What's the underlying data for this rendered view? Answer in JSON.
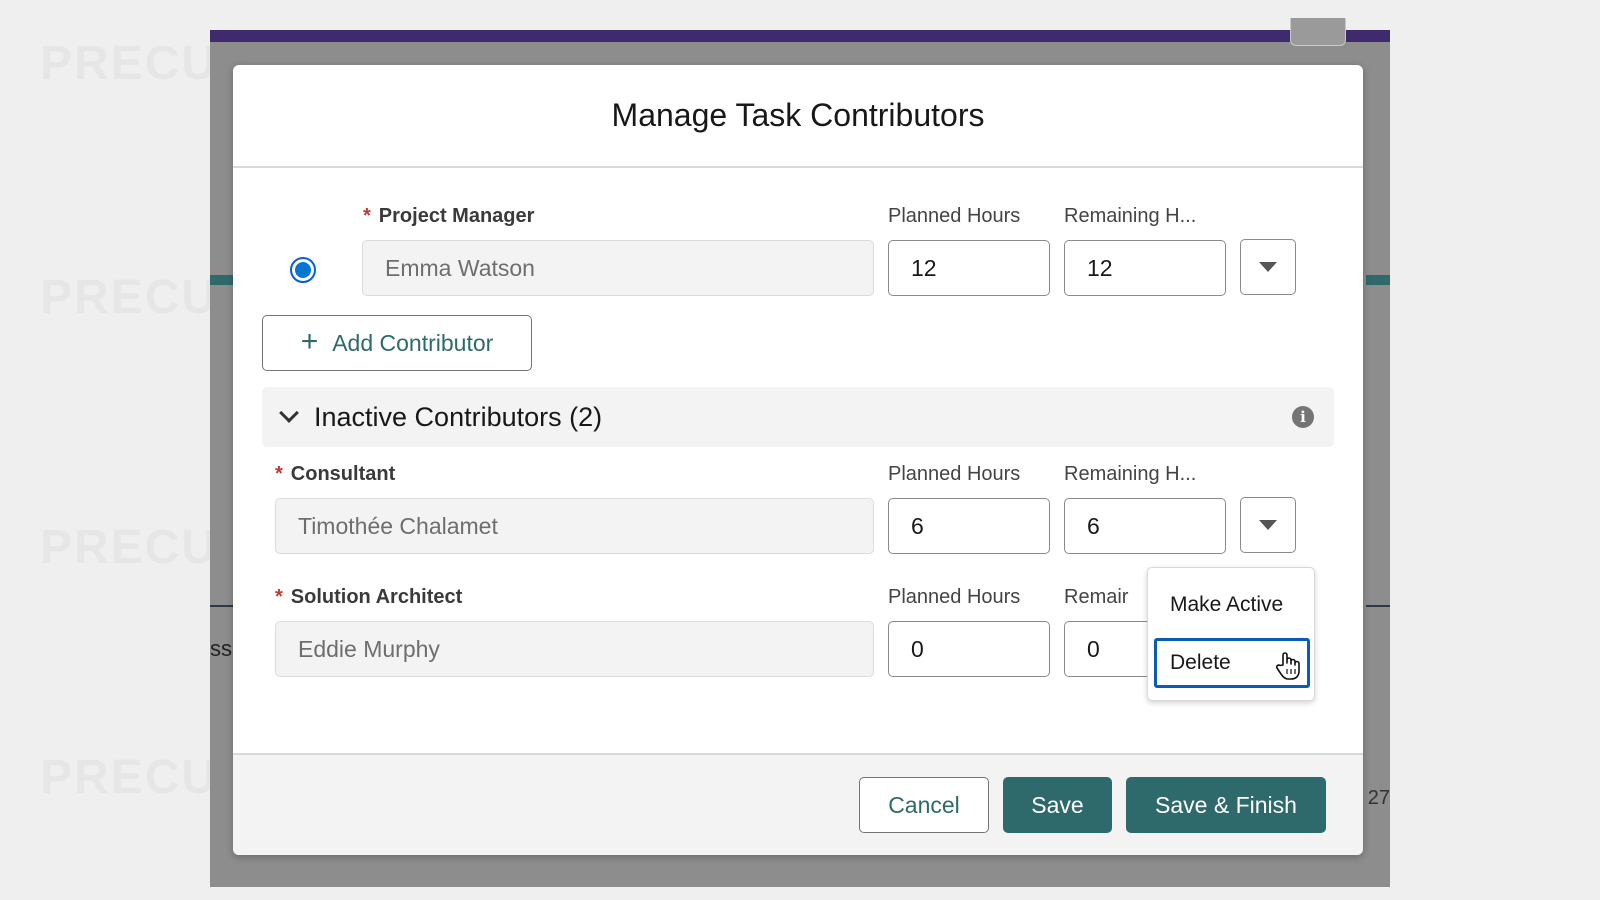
{
  "watermark": {
    "text": "PRECURSIVE"
  },
  "background": {
    "partial_label": "ss",
    "partial_number": "27"
  },
  "modal": {
    "title": "Manage Task Contributors",
    "active_contributor": {
      "role_label": "Project Manager",
      "name": "Emma Watson",
      "planned_label": "Planned Hours",
      "remaining_label": "Remaining H...",
      "planned_hours": "12",
      "remaining_hours": "12",
      "selected": true
    },
    "add_contributor_label": "Add Contributor",
    "inactive_section": {
      "title": "Inactive Contributors (2)"
    },
    "inactive_contributors": [
      {
        "role_label": "Consultant",
        "name": "Timothée Chalamet",
        "planned_label": "Planned Hours",
        "remaining_label": "Remaining H...",
        "planned_hours": "6",
        "remaining_hours": "6"
      },
      {
        "role_label": "Solution Architect",
        "name": "Eddie Murphy",
        "planned_label": "Planned Hours",
        "remaining_label": "Remair",
        "planned_hours": "0",
        "remaining_hours": "0"
      }
    ],
    "row_menu": {
      "items": [
        "Make Active",
        "Delete"
      ],
      "focused": "Delete"
    },
    "footer": {
      "cancel_label": "Cancel",
      "save_label": "Save",
      "save_finish_label": "Save & Finish"
    }
  },
  "colors": {
    "brand": "#2e6a6b",
    "required": "#c23934",
    "radio": "#0176d3",
    "focus": "#0b5cb5",
    "app_header": "#3f2a6e"
  }
}
